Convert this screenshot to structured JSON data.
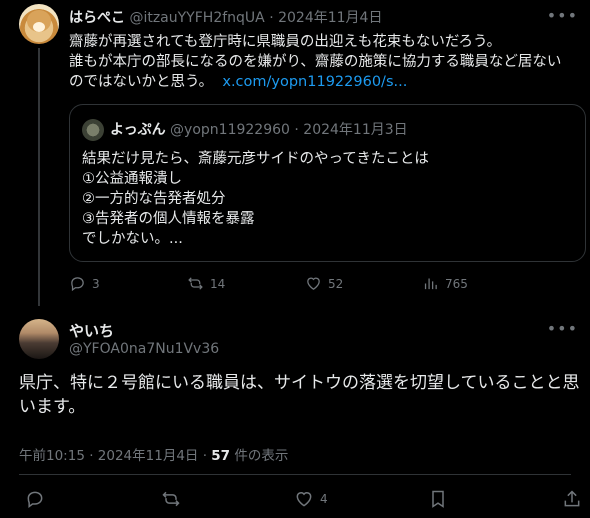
{
  "tweet1": {
    "author_name": "はらぺこ",
    "author_handle": "@itzauYYFH2fnqUA",
    "separator": "·",
    "date": "2024年11月4日",
    "body_lines": [
      "齋藤が再選されても登庁時に県職員の出迎えも花束もないだろう。",
      "誰もが本庁の部長になるのを嫌がり、齋藤の施策に協力する職員など居ない",
      "のではないかと思う。"
    ],
    "link_text": "x.com/yopn11922960/s...",
    "quote": {
      "author_name": "よっぷん",
      "author_handle": "@yopn11922960",
      "date": "2024年11月3日",
      "lines": [
        "結果だけ見たら、斎藤元彦サイドのやってきたことは",
        "①公益通報潰し",
        "②一方的な告発者処分",
        "③告発者の個人情報を暴露",
        "でしかない。..."
      ]
    },
    "actions": {
      "replies": "3",
      "retweets": "14",
      "likes": "52",
      "views": "765"
    }
  },
  "tweet2": {
    "author_name": "やいち",
    "author_handle": "@YFOA0na7Nu1Vv36",
    "body_lines": [
      "県庁、特に２号館にいる職員は、サイトウの落選を切望していることと思",
      "います。"
    ],
    "timestamp": "午前10:15 · 2024年11月4日 · ",
    "view_count": "57",
    "view_suffix": " 件の表示",
    "actions": {
      "likes": "4"
    }
  },
  "icons": {
    "more": "more-horizontal-icon",
    "reply": "reply-icon",
    "retweet": "retweet-icon",
    "like": "heart-icon",
    "views": "bar-chart-icon",
    "bookmark": "bookmark-icon",
    "share": "share-icon"
  },
  "colors": {
    "background": "#000000",
    "text": "#e7e9ea",
    "secondary": "#71767b",
    "link": "#1d9bf0",
    "border": "#2f3336"
  }
}
